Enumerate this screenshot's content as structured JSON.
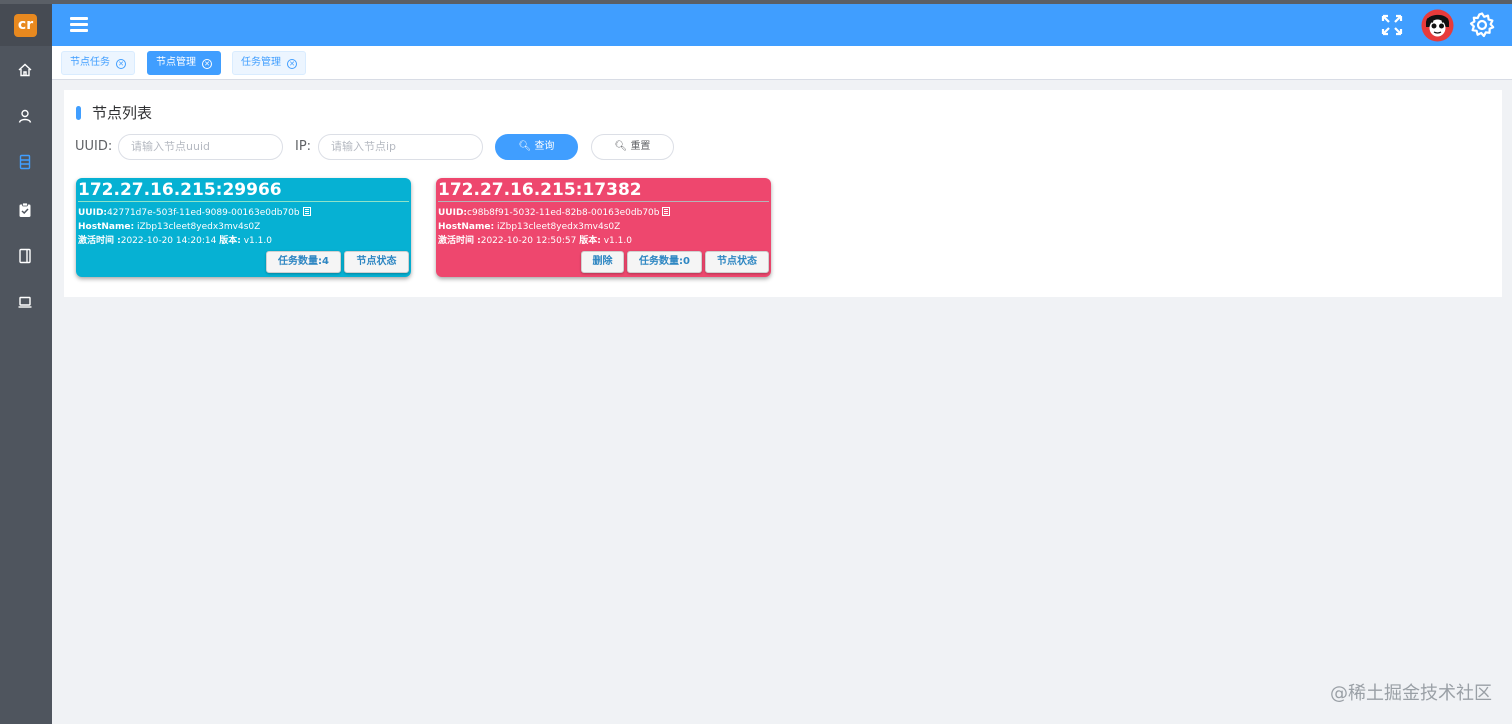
{
  "sidebar": {
    "logo_text": "cr",
    "items": [
      {
        "icon": "home-icon"
      },
      {
        "icon": "user-icon"
      },
      {
        "icon": "list-icon",
        "active": true
      },
      {
        "icon": "clipboard-check-icon"
      },
      {
        "icon": "notebook-icon"
      },
      {
        "icon": "laptop-icon"
      }
    ]
  },
  "header": {
    "menu_icon": "hamburger-menu-icon",
    "fullscreen_icon": "fullscreen-icon",
    "avatar": "avatar",
    "settings_icon": "gear-icon"
  },
  "tags": [
    {
      "label": "节点任务",
      "active": false
    },
    {
      "label": "节点管理",
      "active": true
    },
    {
      "label": "任务管理",
      "active": false
    }
  ],
  "panel": {
    "title": "节点列表",
    "uuid_label": "UUID:",
    "uuid_placeholder": "请输入节点uuid",
    "ip_label": "IP:",
    "ip_placeholder": "请输入节点ip",
    "search_label": "查询",
    "reset_label": "重置"
  },
  "nodes": [
    {
      "address": "172.27.16.215:29966",
      "uuid_label": "UUID:",
      "uuid": "42771d7e-503f-11ed-9089-00163e0db70b",
      "hostname_label": "HostName:",
      "hostname": "iZbp13cleet8yedx3mv4s0Z",
      "activated_label": "激活时间 :",
      "activated": "2022-10-20 14:20:14",
      "version_label": "版本:",
      "version": "v1.1.0",
      "task_count_label": "任务数量:4",
      "status_label": "节点状态",
      "color": "#06b1d3"
    },
    {
      "address": "172.27.16.215:17382",
      "uuid_label": "UUID:",
      "uuid": "c98b8f91-5032-11ed-82b8-00163e0db70b",
      "hostname_label": "HostName:",
      "hostname": "iZbp13cleet8yedx3mv4s0Z",
      "activated_label": "激活时间 :",
      "activated": "2022-10-20 12:50:57",
      "version_label": "版本:",
      "version": "v1.1.0",
      "delete_label": "删除",
      "task_count_label": "任务数量:0",
      "status_label": "节点状态",
      "color": "#ee476e"
    }
  ],
  "watermark": "@稀土掘金技术社区",
  "colors": {
    "header": "#409eff",
    "sidebar": "#4f555e",
    "accent": "#409eff"
  }
}
